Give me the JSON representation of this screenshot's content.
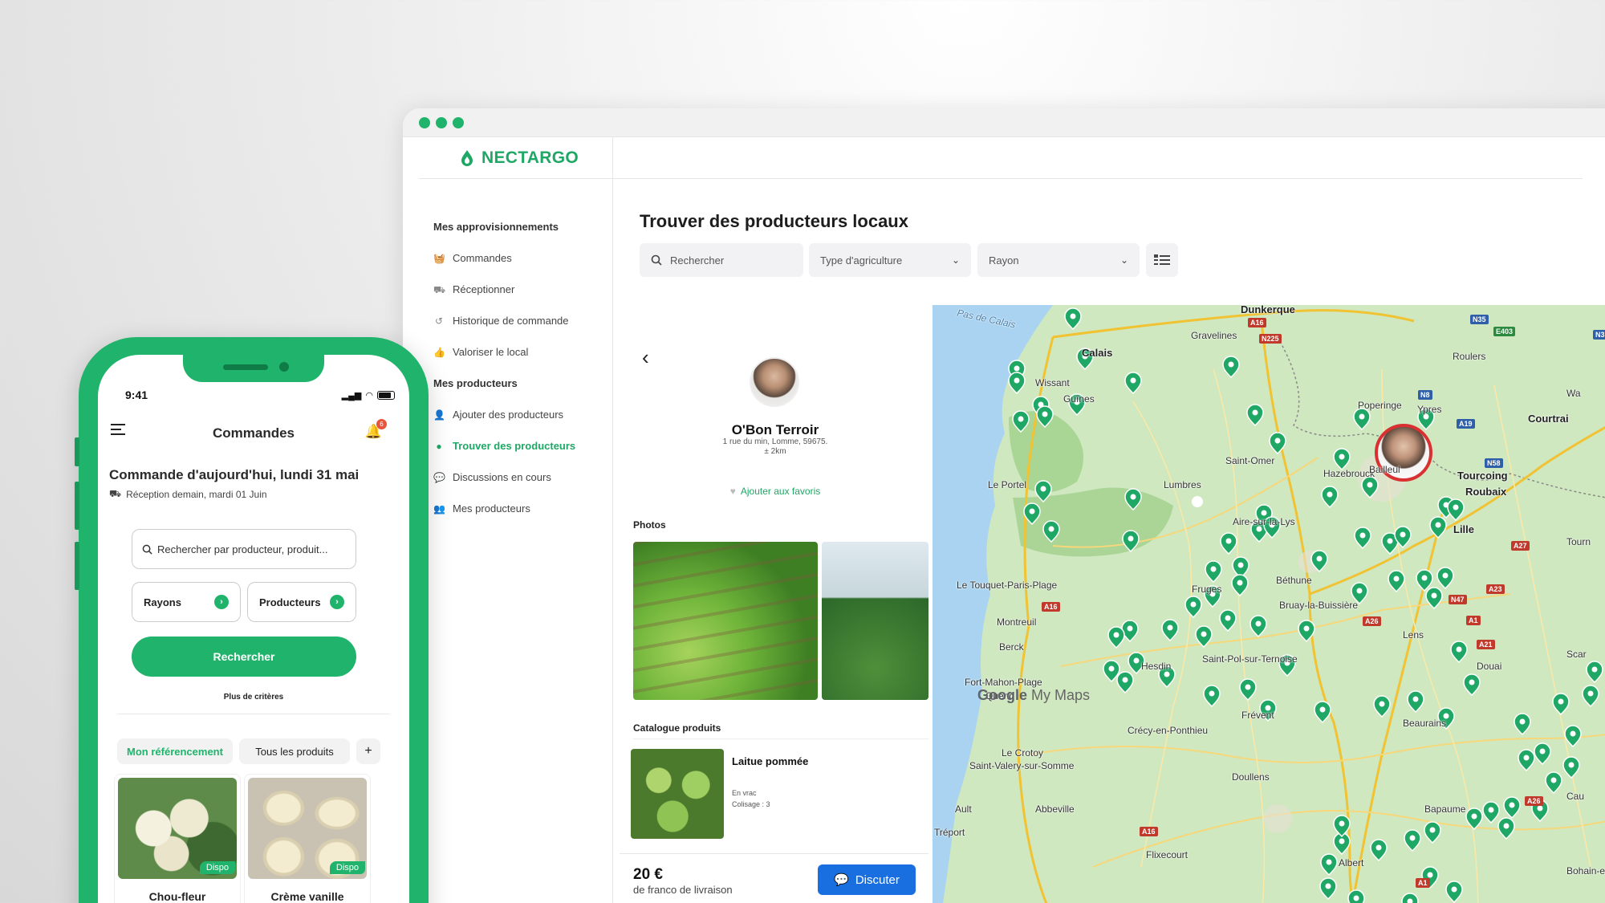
{
  "browser": {
    "brand": "NECTARGO",
    "colors": {
      "brand_green": "#1fa865",
      "accent_blue": "#1a6fe0",
      "pin_green": "#1fa865",
      "selected_ring": "#d93131"
    }
  },
  "sidebar": {
    "section1": "Mes approvisionnements",
    "items1": [
      {
        "label": "Commandes",
        "icon": "basket-icon"
      },
      {
        "label": "Réceptionner",
        "icon": "truck-icon"
      },
      {
        "label": "Historique de commande",
        "icon": "history-icon"
      },
      {
        "label": "Valoriser le local",
        "icon": "thumbs-up-icon"
      }
    ],
    "section2": "Mes producteurs",
    "items2": [
      {
        "label": "Ajouter des producteurs",
        "icon": "add-user-icon"
      },
      {
        "label": "Trouver des producteurs",
        "icon": "location-pin-icon",
        "active": true
      },
      {
        "label": "Discussions en cours",
        "icon": "chat-icon"
      },
      {
        "label": "Mes producteurs",
        "icon": "users-icon"
      }
    ]
  },
  "main": {
    "title": "Trouver des producteurs locaux",
    "search_placeholder": "Rechercher",
    "filter_type": "Type d'agriculture",
    "filter_rayon": "Rayon"
  },
  "producer": {
    "name": "O'Bon Terroir",
    "address": "1 rue du min, Lomme, 59675.",
    "distance": "± 2km",
    "favorite_label": "Ajouter aux favoris",
    "photos_title": "Photos",
    "catalog_title": "Catalogue produits",
    "product": {
      "name": "Laitue pommée",
      "meta1": "En vrac",
      "meta2": "Colisage : 3"
    },
    "price": "20 €",
    "franco": "de franco de livraison",
    "chat_button": "Discuter"
  },
  "map": {
    "labels": [
      {
        "t": "Pas de Calais",
        "c": "sea"
      },
      {
        "t": "Dunkerque",
        "c": "big"
      },
      {
        "t": "Gravelines",
        "c": ""
      },
      {
        "t": "Calais",
        "c": "big"
      },
      {
        "t": "Wissant",
        "c": ""
      },
      {
        "t": "Guînes",
        "c": ""
      },
      {
        "t": "Poperinge",
        "c": ""
      },
      {
        "t": "Ypres",
        "c": ""
      },
      {
        "t": "Roulers",
        "c": ""
      },
      {
        "t": "Courtrai",
        "c": "big"
      },
      {
        "t": "Saint-Omer",
        "c": ""
      },
      {
        "t": "Hazebrouck",
        "c": ""
      },
      {
        "t": "Bailleul",
        "c": ""
      },
      {
        "t": "Tourcoing",
        "c": "big"
      },
      {
        "t": "Roubaix",
        "c": "big"
      },
      {
        "t": "Le Portel",
        "c": ""
      },
      {
        "t": "Lumbres",
        "c": ""
      },
      {
        "t": "Aire-sur-la-Lys",
        "c": ""
      },
      {
        "t": "Lille",
        "c": "big"
      },
      {
        "t": "Le Touquet-Paris-Plage",
        "c": ""
      },
      {
        "t": "Fruges",
        "c": ""
      },
      {
        "t": "Béthune",
        "c": ""
      },
      {
        "t": "Bruay-la-Buissière",
        "c": ""
      },
      {
        "t": "Montreuil",
        "c": ""
      },
      {
        "t": "Berck",
        "c": ""
      },
      {
        "t": "Lens",
        "c": ""
      },
      {
        "t": "Hesdin",
        "c": ""
      },
      {
        "t": "Saint-Pol-sur-Ternoise",
        "c": ""
      },
      {
        "t": "Douai",
        "c": ""
      },
      {
        "t": "Fort-Mahon-Plage",
        "c": ""
      },
      {
        "t": "Quend",
        "c": ""
      },
      {
        "t": "Frévent",
        "c": ""
      },
      {
        "t": "Beaurains",
        "c": ""
      },
      {
        "t": "Crécy-en-Ponthieu",
        "c": ""
      },
      {
        "t": "Le Crotoy",
        "c": ""
      },
      {
        "t": "Saint-Valery-sur-Somme",
        "c": ""
      },
      {
        "t": "Doullens",
        "c": ""
      },
      {
        "t": "Ault",
        "c": ""
      },
      {
        "t": "Abbeville",
        "c": ""
      },
      {
        "t": "Bapaume",
        "c": ""
      },
      {
        "t": "Tréport",
        "c": ""
      },
      {
        "t": "Flixecourt",
        "c": ""
      },
      {
        "t": "Albert",
        "c": ""
      },
      {
        "t": "Bohain-e",
        "c": ""
      },
      {
        "t": "Tourn",
        "c": ""
      },
      {
        "t": "Wa",
        "c": ""
      },
      {
        "t": "Scar",
        "c": ""
      },
      {
        "t": "Cau",
        "c": ""
      }
    ],
    "roads": [
      "A16",
      "N225",
      "N35",
      "E403",
      "N3",
      "N8",
      "A19",
      "N58",
      "A16",
      "N47",
      "A26",
      "A1",
      "A21",
      "A23",
      "A27",
      "A16",
      "A1",
      "A26"
    ],
    "attribution_brand": "Google",
    "attribution_product": "My Maps"
  },
  "phone": {
    "time": "9:41",
    "title": "Commandes",
    "notification_count": "6",
    "order_title": "Commande d'aujourd'hui, lundi 31 mai",
    "order_sub": "Réception demain, mardi 01 Juin",
    "search_placeholder": "Rechercher par producteur, produit...",
    "chip_rayons": "Rayons",
    "chip_producteurs": "Producteurs",
    "cta": "Rechercher",
    "more": "Plus de critères",
    "tab_ref": "Mon référencement",
    "tab_all": "Tous les produits",
    "tab_add": "+",
    "products": [
      {
        "name": "Chou-fleur",
        "badge": "Dispo"
      },
      {
        "name": "Crème vanille",
        "badge": "Dispo"
      }
    ]
  }
}
